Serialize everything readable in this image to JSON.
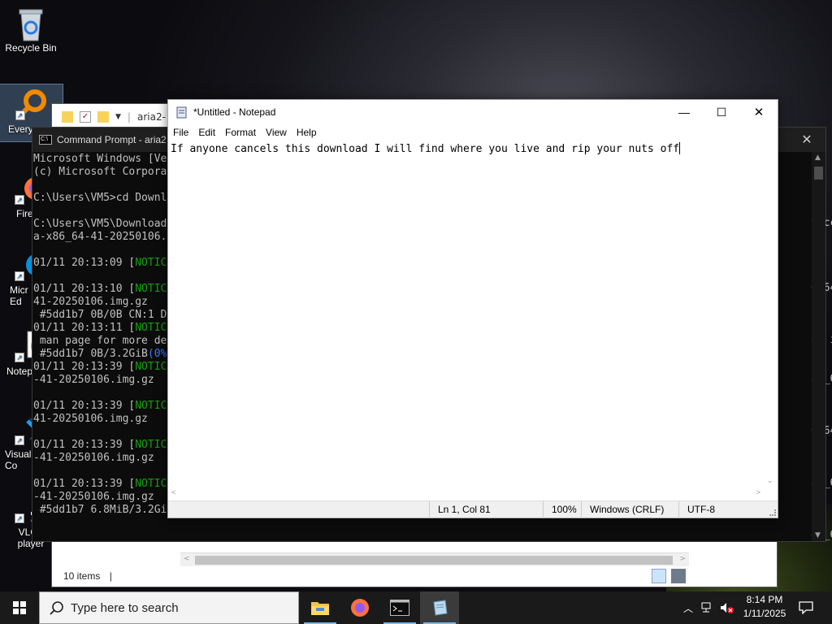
{
  "desktop": {
    "icons": [
      {
        "label": "Recycle Bin"
      },
      {
        "label": "Every"
      },
      {
        "label": "Fire"
      },
      {
        "label": "Micr Ed"
      },
      {
        "label": "Notep"
      },
      {
        "label": "Visual Co"
      },
      {
        "label": "VLC r player"
      }
    ]
  },
  "explorer": {
    "title_fragment": "aria2-",
    "status": "10 items"
  },
  "cmd": {
    "title": "Command Prompt - aria2",
    "close_glyph": "✕",
    "lines": [
      "Microsoft Windows [Ve",
      "(c) Microsoft Corpora",
      "",
      "C:\\Users\\VM5>cd Downl",
      "",
      "C:\\Users\\VM5\\Download",
      "a-x86_64-41-20250106.",
      "",
      "01/11 20:13:09 [NOTIC",
      "",
      "01/11 20:13:10 [NOTIC",
      "41-20250106.img.gz",
      " #5dd1b7 0B/0B CN:1 D",
      "01/11 20:13:11 [NOTIC",
      " man page for more de",
      " #5dd1b7 0B/3.2GiB(0%",
      "01/11 20:13:39 [NOTIC",
      "-41-20250106.img.gz",
      "",
      "01/11 20:13:39 [NOTIC",
      "41-20250106.img.gz",
      "",
      "01/11 20:13:39 [NOTIC",
      "-41-20250106.img.gz",
      "",
      "01/11 20:13:39 [NOTIC",
      "-41-20250106.img.gz",
      " #5dd1b7 6.8MiB/3.2Gi"
    ],
    "right_lines": [
      "toccer",
      "",
      "",
      "",
      "",
      "6_64-",
      "",
      "",
      "",
      "on in",
      "",
      "",
      "86_64",
      "",
      "",
      "",
      "6_64-",
      "",
      "",
      "",
      "86_64",
      "",
      "",
      "",
      "86_64"
    ]
  },
  "notepad": {
    "title": "*Untitled - Notepad",
    "menu": [
      "File",
      "Edit",
      "Format",
      "View",
      "Help"
    ],
    "text": "If anyone cancels this download I will find where you live and rip your nuts off",
    "status": {
      "position": "Ln 1, Col 81",
      "zoom": "100%",
      "line_ending": "Windows (CRLF)",
      "encoding": "UTF-8"
    },
    "controls": {
      "minimize": "—",
      "maximize": "☐",
      "close": "✕"
    }
  },
  "taskbar": {
    "search_placeholder": "Type here to search",
    "time": "8:14 PM",
    "date": "1/11/2025"
  }
}
